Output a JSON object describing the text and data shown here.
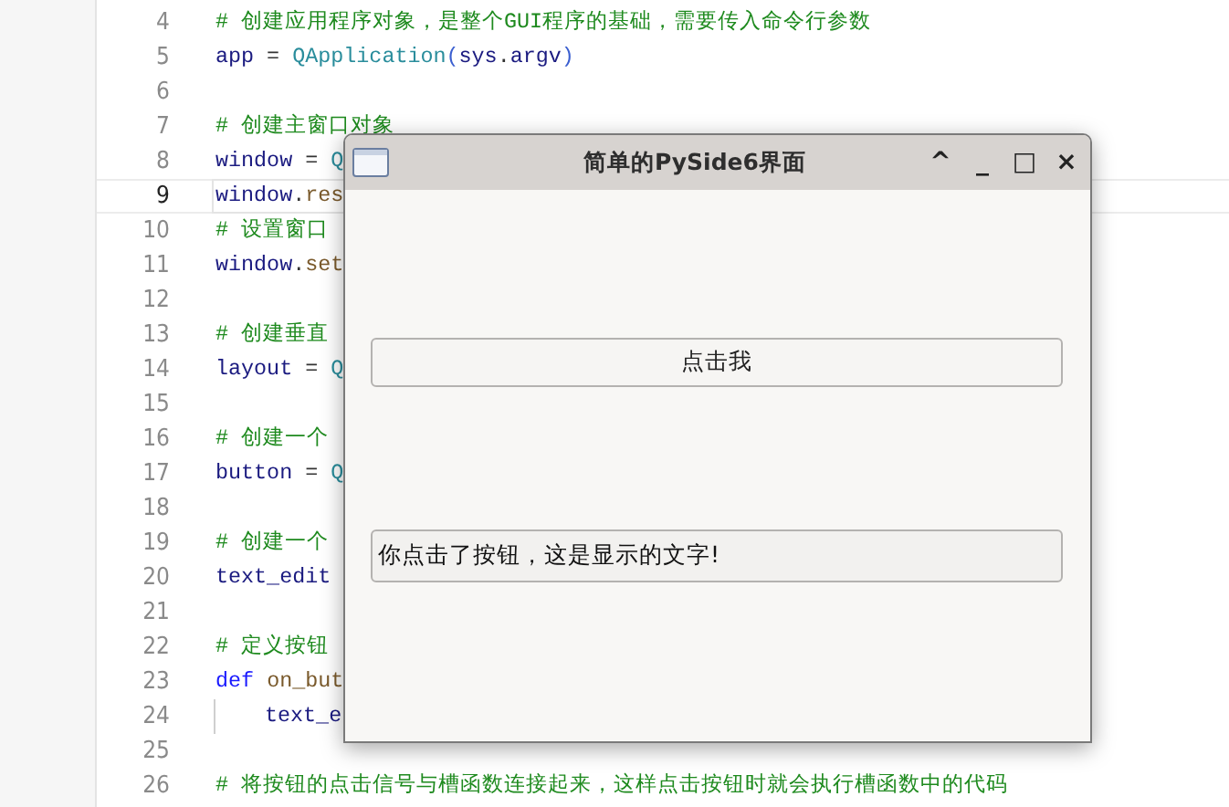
{
  "editor": {
    "lines": [
      {
        "number": "4",
        "current": false,
        "indented": false,
        "tokens": [
          {
            "kind": "comment",
            "text": "# 创建应用程序对象，是整个GUI程序的基础，需要传入命令行参数"
          }
        ]
      },
      {
        "number": "5",
        "current": false,
        "indented": false,
        "tokens": [
          {
            "kind": "name",
            "text": "app"
          },
          {
            "kind": "op",
            "text": " = "
          },
          {
            "kind": "class",
            "text": "QApplication"
          },
          {
            "kind": "paren",
            "text": "("
          },
          {
            "kind": "name",
            "text": "sys"
          },
          {
            "kind": "op",
            "text": "."
          },
          {
            "kind": "name",
            "text": "argv"
          },
          {
            "kind": "paren",
            "text": ")"
          }
        ]
      },
      {
        "number": "6",
        "current": false,
        "indented": false
      },
      {
        "number": "7",
        "current": false,
        "indented": false,
        "tokens": [
          {
            "kind": "comment",
            "text": "# 创建主窗口对象"
          }
        ]
      },
      {
        "number": "8",
        "current": false,
        "indented": false,
        "tokens": [
          {
            "kind": "name",
            "text": "window"
          },
          {
            "kind": "op",
            "text": " = "
          },
          {
            "kind": "class",
            "text": "Q"
          }
        ]
      },
      {
        "number": "9",
        "current": true,
        "indented": false,
        "tokens": [
          {
            "kind": "name",
            "text": "window"
          },
          {
            "kind": "op",
            "text": "."
          },
          {
            "kind": "method",
            "text": "res"
          }
        ]
      },
      {
        "number": "10",
        "current": false,
        "indented": false,
        "tokens": [
          {
            "kind": "comment",
            "text": "# 设置窗口"
          }
        ]
      },
      {
        "number": "11",
        "current": false,
        "indented": false,
        "tokens": [
          {
            "kind": "name",
            "text": "window"
          },
          {
            "kind": "op",
            "text": "."
          },
          {
            "kind": "method",
            "text": "set"
          }
        ]
      },
      {
        "number": "12",
        "current": false,
        "indented": false
      },
      {
        "number": "13",
        "current": false,
        "indented": false,
        "tokens": [
          {
            "kind": "comment",
            "text": "# 创建垂直"
          }
        ]
      },
      {
        "number": "14",
        "current": false,
        "indented": false,
        "tokens": [
          {
            "kind": "name",
            "text": "layout"
          },
          {
            "kind": "op",
            "text": " = "
          },
          {
            "kind": "class",
            "text": "Q"
          }
        ]
      },
      {
        "number": "15",
        "current": false,
        "indented": false
      },
      {
        "number": "16",
        "current": false,
        "indented": false,
        "tokens": [
          {
            "kind": "comment",
            "text": "# 创建一个"
          }
        ]
      },
      {
        "number": "17",
        "current": false,
        "indented": false,
        "tokens": [
          {
            "kind": "name",
            "text": "button"
          },
          {
            "kind": "op",
            "text": " = "
          },
          {
            "kind": "class",
            "text": "Q"
          }
        ]
      },
      {
        "number": "18",
        "current": false,
        "indented": false
      },
      {
        "number": "19",
        "current": false,
        "indented": false,
        "tokens": [
          {
            "kind": "comment",
            "text": "# 创建一个"
          }
        ]
      },
      {
        "number": "20",
        "current": false,
        "indented": false,
        "tokens": [
          {
            "kind": "name",
            "text": "text_edit"
          }
        ]
      },
      {
        "number": "21",
        "current": false,
        "indented": false
      },
      {
        "number": "22",
        "current": false,
        "indented": false,
        "tokens": [
          {
            "kind": "comment",
            "text": "# 定义按钮"
          }
        ]
      },
      {
        "number": "23",
        "current": false,
        "indented": false,
        "tokens": [
          {
            "kind": "keyword",
            "text": "def "
          },
          {
            "kind": "method",
            "text": "on_but"
          }
        ]
      },
      {
        "number": "24",
        "current": false,
        "indented": true,
        "tokens": [
          {
            "kind": "name",
            "text": "text_e"
          }
        ]
      },
      {
        "number": "25",
        "current": false,
        "indented": false
      },
      {
        "number": "26",
        "current": false,
        "indented": false,
        "tokens": [
          {
            "kind": "comment",
            "text": "# 将按钮的点击信号与槽函数连接起来，这样点击按钮时就会执行槽函数中的代码"
          }
        ]
      }
    ]
  },
  "dialog": {
    "title": "简单的PySide6界面",
    "controls": [
      "^",
      "_",
      "□",
      "×"
    ],
    "button": "点击我",
    "text_field": {
      "value": "你点击了按钮，这是显示的文字!"
    }
  }
}
